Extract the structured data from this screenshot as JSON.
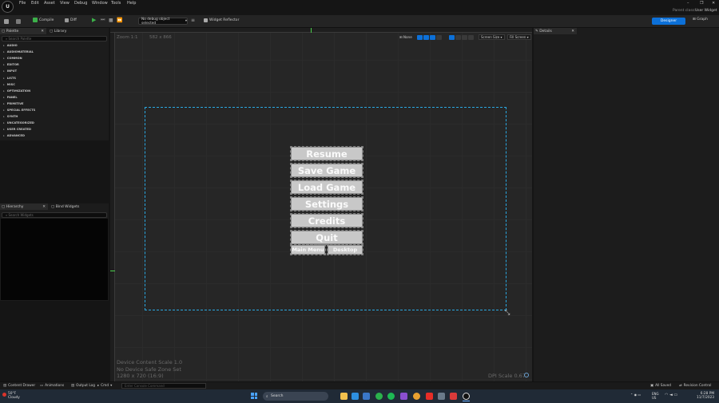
{
  "menubar": {
    "logo": "U",
    "items": [
      "File",
      "Edit",
      "Asset",
      "View",
      "Debug",
      "Window",
      "Tools",
      "Help"
    ],
    "parent_label": "Parent class:",
    "parent_value": "User Widget",
    "win_controls": [
      "–",
      "❐",
      "✕"
    ]
  },
  "toolbar": {
    "compile": "Compile",
    "diff": "Diff",
    "debug_select": "No debug object selected",
    "widget_reflector": "Widget Reflector",
    "designer": "Designer",
    "graph": "Graph"
  },
  "palette": {
    "tabs": [
      "Palette",
      "Library"
    ],
    "search_placeholder": "Search Palette",
    "categories": [
      "AUDIO",
      "AUDIOMATERIAL",
      "COMMON",
      "EDITOR",
      "INPUT",
      "LISTS",
      "MISC",
      "OPTIMIZATION",
      "PANEL",
      "PRIMITIVE",
      "SPECIAL EFFECTS",
      "SYNTH",
      "UNCATEGORIZED",
      "USER CREATED",
      "ADVANCED"
    ]
  },
  "hierarchy": {
    "tabs": [
      "Hierarchy",
      "Bind Widgets"
    ],
    "search_placeholder": "Search Widgets"
  },
  "canvas": {
    "zoom": "Zoom 1:1",
    "resolution": "582 x 866",
    "tools": {
      "mode": "None",
      "screen_size": "Screen Size",
      "fill_screen": "Fill Screen"
    },
    "buttons": [
      "Resume",
      "Save Game",
      "Load Game",
      "Settings",
      "Credits",
      "Quit"
    ],
    "small_buttons": [
      "Main Menu",
      "Desktop"
    ],
    "info": [
      "Device Content Scale 1.0",
      "No Device Safe Zone Set",
      "1280 x 720 (16:9)"
    ],
    "dpi": "DPI Scale 0.67"
  },
  "details": {
    "tab": "Details"
  },
  "statusbar": {
    "content_drawer": "Content Drawer",
    "animations": "Animations",
    "output_log": "Output Log",
    "cmd": "Cmd",
    "console_placeholder": "Enter Console Command",
    "all_saved": "All Saved",
    "revision": "Revision Control"
  },
  "taskbar": {
    "temp": "50°F",
    "weather": "Cloudy",
    "search": "Search",
    "lang": "ENG",
    "region": "US",
    "time": "6:28 PM",
    "date": "11/7/2023"
  },
  "colors": {
    "accent": "#0c70d8",
    "selection": "#2aa7e0",
    "button_fill": "#c8c8c8"
  }
}
